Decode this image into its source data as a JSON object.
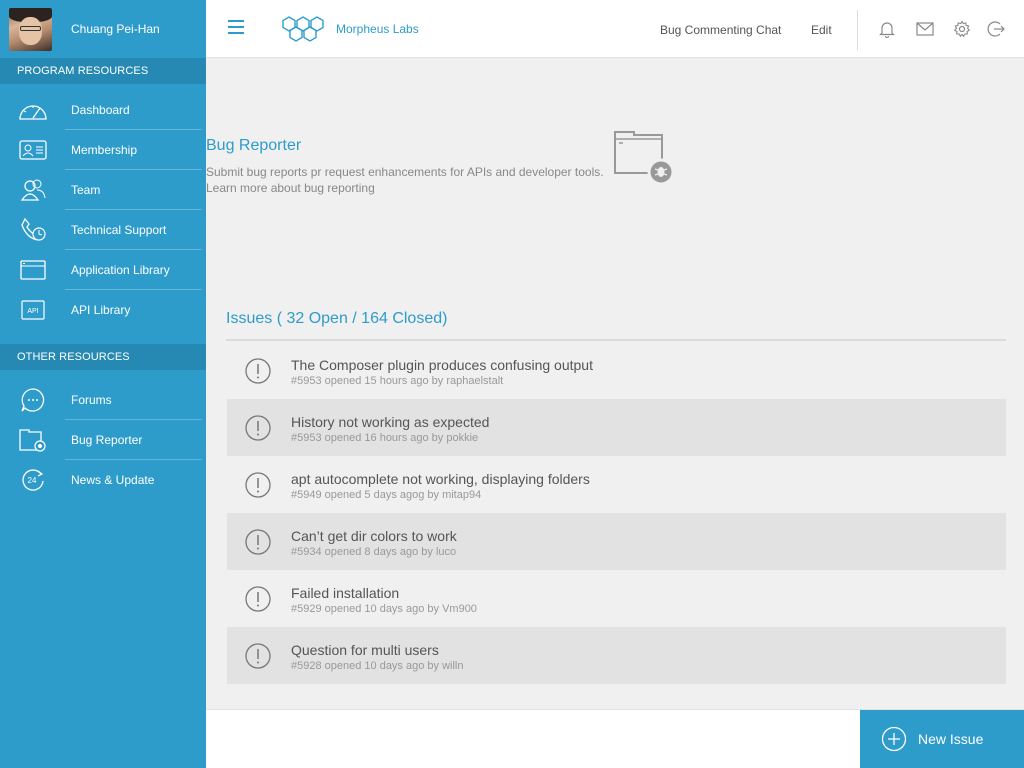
{
  "user": {
    "name": "Chuang Pei-Han"
  },
  "sidebar": {
    "program_header": "PROGRAM RESOURCES",
    "program_items": [
      {
        "label": "Dashboard",
        "icon": "dashboard-gauge-icon"
      },
      {
        "label": "Membership",
        "icon": "membership-card-icon"
      },
      {
        "label": "Team",
        "icon": "team-people-icon"
      },
      {
        "label": "Technical Support",
        "icon": "support-phone-icon"
      },
      {
        "label": "Application Library",
        "icon": "application-window-icon"
      },
      {
        "label": "API Library",
        "icon": "api-box-icon",
        "icon_text": "API"
      }
    ],
    "other_header": "OTHER RESOURCES",
    "other_items": [
      {
        "label": "Forums",
        "icon": "forum-chat-icon"
      },
      {
        "label": "Bug Reporter",
        "icon": "bug-folder-icon"
      },
      {
        "label": "News & Update",
        "icon": "news-24-icon",
        "icon_text": "24"
      }
    ]
  },
  "topbar": {
    "brand": "Morpheus Labs",
    "link_chat": "Bug Commenting Chat",
    "link_edit": "Edit",
    "icons": [
      "bell-icon",
      "mail-icon",
      "settings-gear-icon",
      "logout-icon"
    ]
  },
  "hero": {
    "title": "Bug Reporter",
    "description": "Submit bug reports pr request enhancements for APIs and developer tools.",
    "learn_more": "Learn more about bug reporting"
  },
  "issues": {
    "heading": "Issues ( 32 Open / 164 Closed)",
    "list": [
      {
        "title": "The Composer plugin produces confusing output",
        "meta": "#5953 opened 15 hours ago by raphaelstalt"
      },
      {
        "title": "History not working as expected",
        "meta": "#5953 opened 16 hours ago by pokkie"
      },
      {
        "title": "apt autocomplete not working, displaying folders",
        "meta": "#5949 opened 5 days agog by mitap94"
      },
      {
        "title": "Can’t get dir colors to work",
        "meta": "#5934 opened 8 days ago by luco"
      },
      {
        "title": "Failed installation",
        "meta": "#5929 opened 10 days ago by Vm900"
      },
      {
        "title": "Question for multi users",
        "meta": "#5928 opened 10 days ago by willn"
      }
    ]
  },
  "actions": {
    "new_issue": "New Issue"
  },
  "colors": {
    "primary": "#2e9ccb",
    "section_header": "#2689b4",
    "background": "#f0f0f0",
    "row_alt": "#e2e2e2"
  }
}
